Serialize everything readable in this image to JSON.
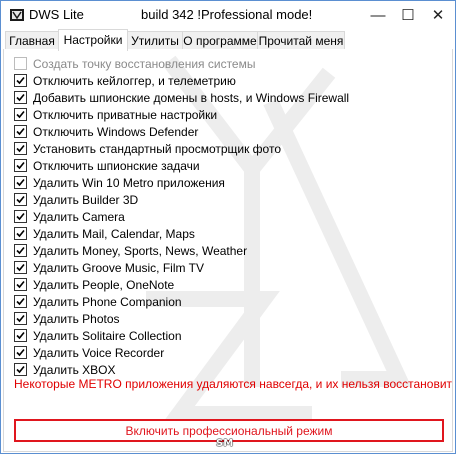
{
  "window": {
    "title_app": "DWS Lite",
    "title_build": "build 342  !Professional mode!",
    "minimize_symbol": "—",
    "maximize_symbol": "☐",
    "close_symbol": "✕",
    "icon": "app-icon",
    "border_color": "#5b8fd1"
  },
  "tabs": [
    {
      "label": "Главная",
      "active": false
    },
    {
      "label": "Настройки",
      "active": true
    },
    {
      "label": "Утилиты",
      "active": false
    },
    {
      "label": "О программе",
      "active": false
    },
    {
      "label": "Прочитай меня",
      "active": false
    }
  ],
  "settings": {
    "restore_point": {
      "label": "Создать точку восстановления системы",
      "checked": false,
      "disabled": true
    },
    "options": [
      {
        "label": "Отключить кейлоггер, и телеметрию",
        "checked": true
      },
      {
        "label": "Добавить шпионские домены в hosts, и Windows Firewall",
        "checked": true
      },
      {
        "label": "Отключить приватные настройки",
        "checked": true
      },
      {
        "label": "Отключить Windows Defender",
        "checked": true
      },
      {
        "label": "Установить стандартный просмотрщик фото",
        "checked": true
      },
      {
        "label": "Отключить шпионские задачи",
        "checked": true
      },
      {
        "label": "Удалить Win 10 Metro приложения",
        "checked": true
      },
      {
        "label": "Удалить Builder 3D",
        "checked": true
      },
      {
        "label": "Удалить Camera",
        "checked": true
      },
      {
        "label": "Удалить Mail, Calendar, Maps",
        "checked": true
      },
      {
        "label": "Удалить Money, Sports, News, Weather",
        "checked": true
      },
      {
        "label": "Удалить Groove Music, Film TV",
        "checked": true
      },
      {
        "label": "Удалить People, OneNote",
        "checked": true
      },
      {
        "label": "Удалить Phone Companion",
        "checked": true
      },
      {
        "label": "Удалить Photos",
        "checked": true
      },
      {
        "label": "Удалить Solitaire Collection",
        "checked": true
      },
      {
        "label": "Удалить Voice Recorder",
        "checked": true
      },
      {
        "label": "Удалить XBOX",
        "checked": true
      }
    ],
    "warning": "Некоторые METRO приложения удаляются навсегда, и их нельзя восстановить",
    "pro_button": "Включить профессиональный режим"
  },
  "logo_text": "SM",
  "colors": {
    "warning": "#e00000",
    "pro_button_border": "#e0161e",
    "tab_bg": "#f0f0f0"
  }
}
